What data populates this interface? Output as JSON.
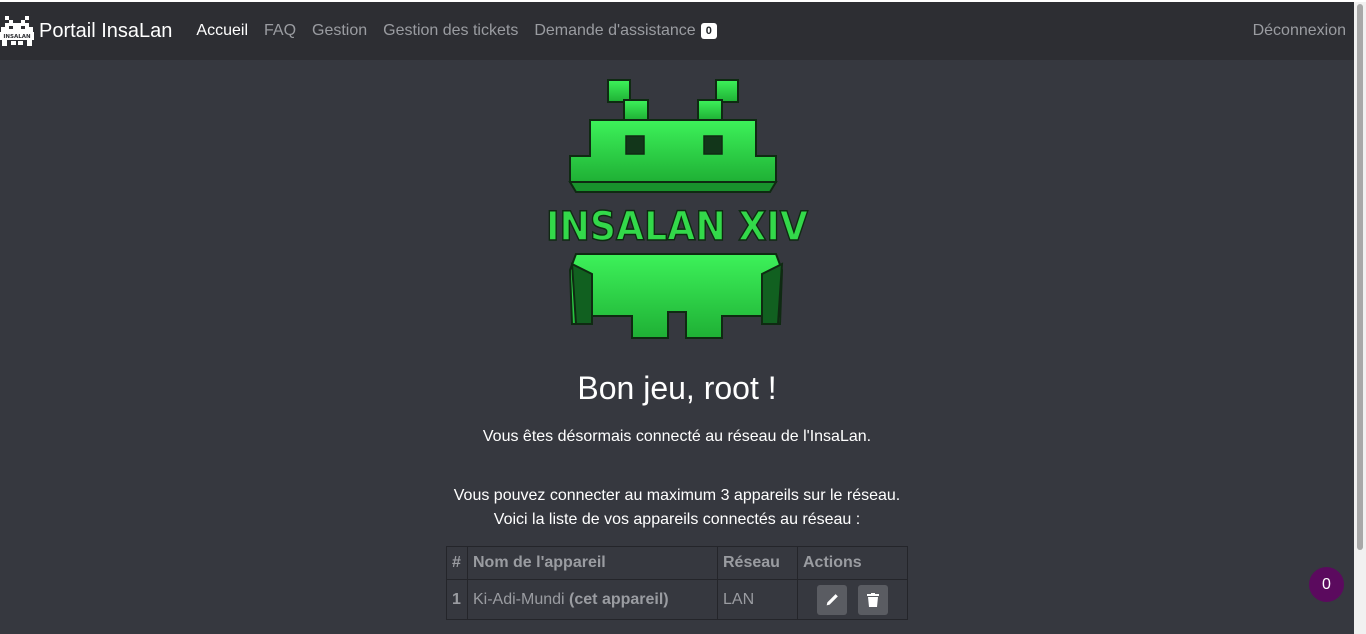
{
  "navbar": {
    "brand_title": "Portail InsaLan",
    "links": [
      {
        "label": "Accueil",
        "active": true
      },
      {
        "label": "FAQ"
      },
      {
        "label": "Gestion"
      },
      {
        "label": "Gestion des tickets"
      },
      {
        "label": "Demande d'assistance",
        "badge": "0"
      }
    ],
    "logout_label": "Déconnexion",
    "brand_logo_text": "INSALAN"
  },
  "hero": {
    "logo_text": "INSALAN XIV",
    "logo_icon": "space-invader-logo",
    "greeting": "Bon jeu, root !",
    "connected_text": "Vous êtes désormais connecté au réseau de l'InsaLan.",
    "max_devices_text": "Vous pouvez connecter au maximum 3 appareils sur le réseau.",
    "list_intro_text": "Voici la liste de vos appareils connectés au réseau :"
  },
  "devices_table": {
    "headers": [
      "#",
      "Nom de l'appareil",
      "Réseau",
      "Actions"
    ],
    "rows": [
      {
        "index": "1",
        "name": "Ki-Adi-Mundi",
        "note": "(cet appareil)",
        "network": "LAN",
        "actions": [
          "pencil-icon",
          "trash-icon"
        ]
      }
    ]
  },
  "floating_counter": "0",
  "colors": {
    "background": "#36383f",
    "navbar": "#2d2e33",
    "logo_green": "#33d94a",
    "float_button": "#5b0a5e"
  }
}
